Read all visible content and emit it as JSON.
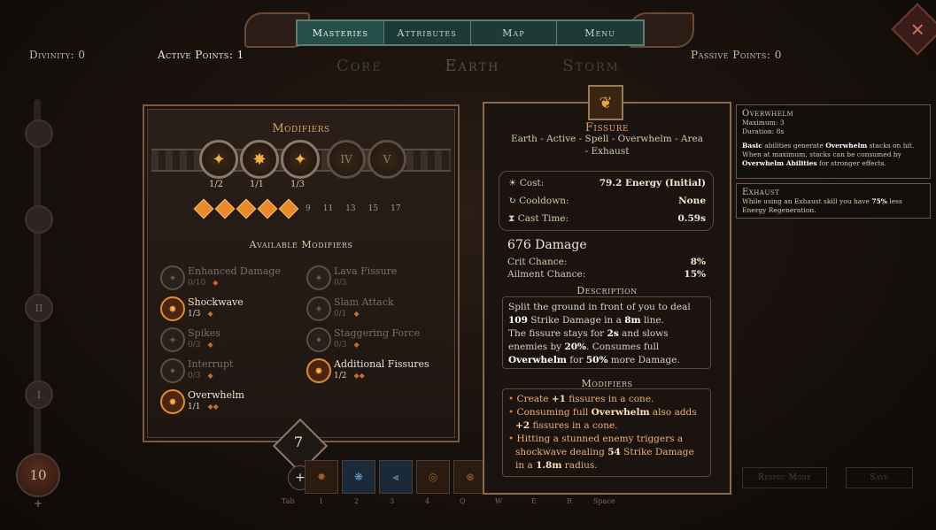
{
  "nav": {
    "tabs": [
      "Masteries",
      "Attributes",
      "Map",
      "Menu"
    ],
    "active": 0
  },
  "header": {
    "divinity": "Divinity: 0",
    "active_points": "Active Points: 1",
    "passive_points": "Passive Points: 0",
    "trees": [
      "Core",
      "Earth",
      "Storm"
    ]
  },
  "left_track": {
    "nodes": [
      "III",
      "II",
      "I"
    ],
    "level": "10"
  },
  "modifiers_panel": {
    "title": "Modifiers",
    "slots": [
      {
        "label": "",
        "count": "1/2",
        "locked": false
      },
      {
        "label": "",
        "count": "1/1",
        "locked": false
      },
      {
        "label": "",
        "count": "1/3",
        "locked": false
      },
      {
        "label": "IV",
        "count": "",
        "locked": true
      },
      {
        "label": "V",
        "count": "",
        "locked": true
      }
    ],
    "pip_numbers": [
      "9",
      "11",
      "13",
      "15",
      "17"
    ],
    "available_title": "Available Modifiers",
    "mods": [
      {
        "name": "Enhanced Damage",
        "count": "0/10",
        "on": false
      },
      {
        "name": "Lava Fissure",
        "count": "0/3",
        "on": false
      },
      {
        "name": "Shockwave",
        "count": "1/3",
        "on": true
      },
      {
        "name": "Slam Attack",
        "count": "0/1",
        "on": false
      },
      {
        "name": "Spikes",
        "count": "0/3",
        "on": false
      },
      {
        "name": "Staggering Force",
        "count": "0/3",
        "on": false
      },
      {
        "name": "Interrupt",
        "count": "0/3",
        "on": false
      },
      {
        "name": "Additional Fissures",
        "count": "1/2",
        "on": true
      },
      {
        "name": "Overwhelm",
        "count": "1/1",
        "on": true
      }
    ]
  },
  "points_badge": {
    "value": "7",
    "add": "+"
  },
  "skillbar": {
    "keys": [
      "Tab",
      "1",
      "2",
      "3",
      "4",
      "Q",
      "W",
      "E",
      "R",
      "Space"
    ],
    "respec": "Respec Mode",
    "save": "Save"
  },
  "skill": {
    "name": "Fissure",
    "tags": "Earth - Active - Spell - Overwhelm - Area - Exhaust",
    "cost_label": "Cost:",
    "cost": "79.2 Energy (Initial)",
    "cooldown_label": "Cooldown:",
    "cooldown": "None",
    "cast_label": "Cast Time:",
    "cast": "0.59s",
    "damage": "676 Damage",
    "crit_label": "Crit Chance:",
    "crit": "8%",
    "ailment_label": "Ailment Chance:",
    "ailment": "15%",
    "desc_head": "Description",
    "mods_head": "Modifiers"
  },
  "tooltips": {
    "overwhelm": {
      "title": "Overwhelm",
      "max": "Maximum: 3",
      "dur": "Duration: 8s"
    },
    "exhaust": {
      "title": "Exhaust"
    }
  },
  "colors": {
    "accent": "#e88a2a",
    "nav": "#1d3a36",
    "frame": "#8a6a4a"
  },
  "icons": [
    "shield-hex-icon",
    "close-icon",
    "fissure-skill-icon",
    "plus-icon"
  ]
}
